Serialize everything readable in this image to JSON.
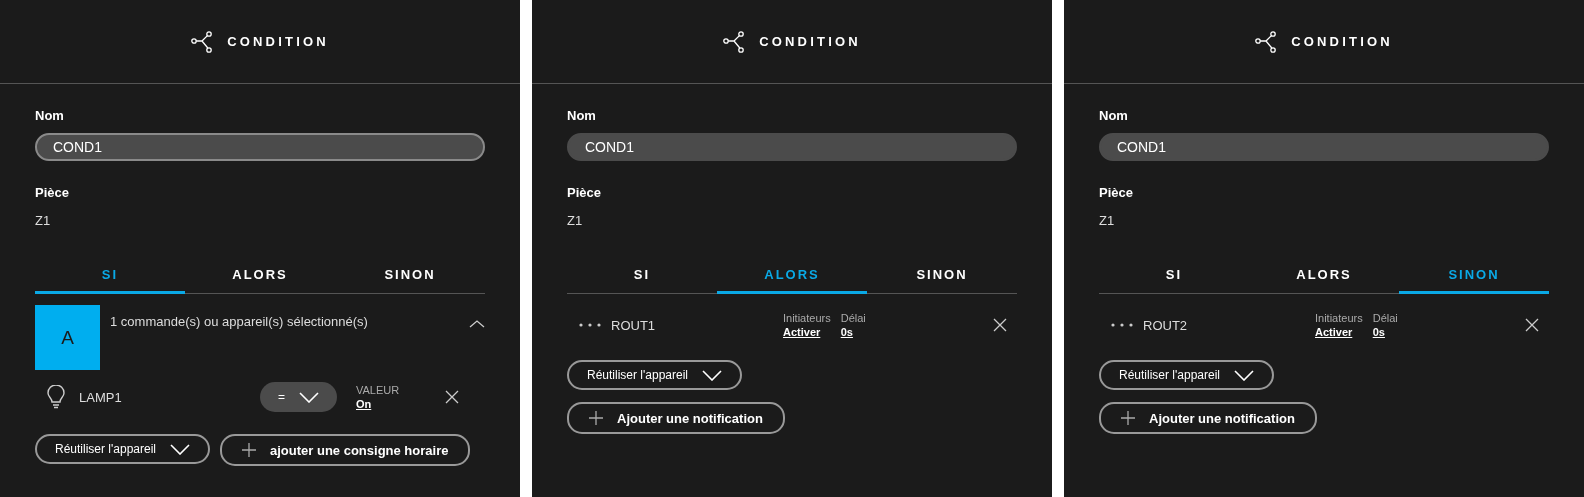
{
  "panels": [
    {
      "title": "CONDITION",
      "name_label": "Nom",
      "name_value": "COND1",
      "name_focused": true,
      "room_label": "Pièce",
      "room_value": "Z1",
      "tabs": [
        {
          "label": "SI",
          "selected": true
        },
        {
          "label": "ALORS",
          "selected": false
        },
        {
          "label": "SINON",
          "selected": false
        }
      ],
      "content": {
        "kind": "condition",
        "avatar": "A",
        "summary": "1 commande(s) ou appareil(s) sélectionné(s)",
        "expanded": true,
        "device": {
          "name": "LAMP1",
          "operator": "=",
          "value_label": "VALEUR",
          "value": "On"
        },
        "reuse_button": "Réutiliser l'appareil",
        "add_button": "ajouter une consigne horaire"
      }
    },
    {
      "title": "CONDITION",
      "name_label": "Nom",
      "name_value": "COND1",
      "name_focused": false,
      "room_label": "Pièce",
      "room_value": "Z1",
      "tabs": [
        {
          "label": "SI",
          "selected": false
        },
        {
          "label": "ALORS",
          "selected": true
        },
        {
          "label": "SINON",
          "selected": false
        }
      ],
      "content": {
        "kind": "action",
        "name": "ROUT1",
        "initiators_label": "Initiateurs",
        "initiators_value": "Activer",
        "delay_label": "Délai",
        "delay_value": "0s",
        "reuse_button": "Réutiliser l'appareil",
        "add_button": "Ajouter une notification"
      }
    },
    {
      "title": "CONDITION",
      "name_label": "Nom",
      "name_value": "COND1",
      "name_focused": false,
      "room_label": "Pièce",
      "room_value": "Z1",
      "tabs": [
        {
          "label": "SI",
          "selected": false
        },
        {
          "label": "ALORS",
          "selected": false
        },
        {
          "label": "SINON",
          "selected": true
        }
      ],
      "content": {
        "kind": "action",
        "name": "ROUT2",
        "initiators_label": "Initiateurs",
        "initiators_value": "Activer",
        "delay_label": "Délai",
        "delay_value": "0s",
        "reuse_button": "Réutiliser l'appareil",
        "add_button": "Ajouter une notification"
      }
    }
  ]
}
